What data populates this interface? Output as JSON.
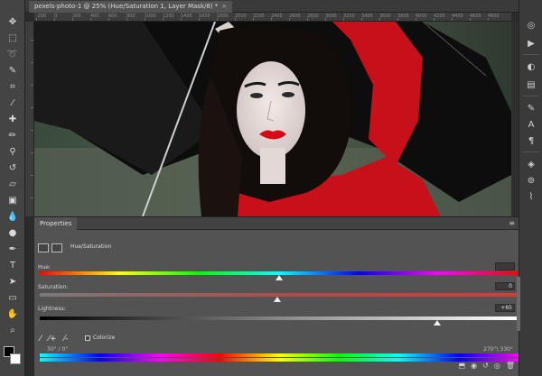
{
  "document": {
    "tab_title": "pexels-photo-1 @ 25% (Hue/Saturation 1, Layer Mask/8) *",
    "close": "×"
  },
  "ruler": {
    "top_labels": [
      "-200",
      "0",
      "200",
      "400",
      "600",
      "800",
      "1000",
      "1200",
      "1400",
      "1600",
      "1800",
      "2000",
      "2200",
      "2400",
      "2600",
      "2800",
      "3000",
      "3200",
      "3400",
      "3600",
      "3800",
      "4000",
      "4200",
      "4400",
      "4600",
      "4800",
      "5000"
    ]
  },
  "toolbar": {
    "tools": [
      "move-icon",
      "marquee-icon",
      "lasso-icon",
      "quick-select-icon",
      "crop-icon",
      "eyedropper-icon",
      "healing-icon",
      "brush-icon",
      "stamp-icon",
      "history-brush-icon",
      "eraser-icon",
      "gradient-icon",
      "blur-icon",
      "dodge-icon",
      "pen-icon",
      "type-icon",
      "path-select-icon",
      "rectangle-icon",
      "hand-icon",
      "zoom-icon",
      "more-icon"
    ]
  },
  "right_panel": {
    "icons": [
      "history-icon",
      "actions-icon",
      "adjustments-icon",
      "libraries-icon",
      "brushes-icon",
      "character-icon",
      "paragraph-icon",
      "layers-icon",
      "channels-icon",
      "paths-icon"
    ]
  },
  "properties": {
    "tab_label": "Properties",
    "menu_icon": "≡",
    "adjustment_title": "Hue/Saturation",
    "hue": {
      "label": "Hue:",
      "value": ""
    },
    "saturation": {
      "label": "Saturation:",
      "value": "0"
    },
    "lightness": {
      "label": "Lightness:",
      "value": "+65"
    },
    "colorize_label": "Colorize",
    "range_left": "30° / 0°",
    "range_right": "270°\\ 330°"
  },
  "colors": {
    "accent_red": "#c8101a",
    "panel_bg": "#535353"
  }
}
